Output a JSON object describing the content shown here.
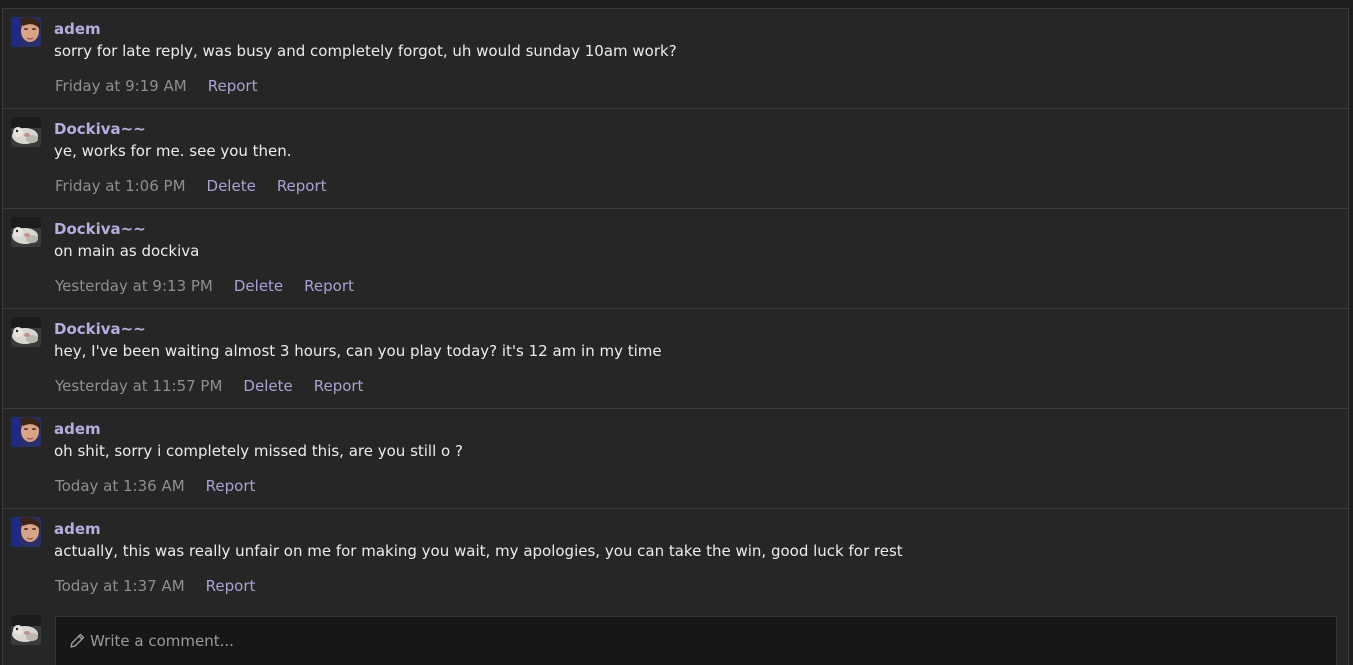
{
  "comments": [
    {
      "author": "adem",
      "avatar": "adem-avatar",
      "text": "sorry for late reply, was busy and completely forgot, uh would sunday 10am work?",
      "time": "Friday at 9:19 AM",
      "delete_label": "",
      "report_label": "Report"
    },
    {
      "author": "Dockiva~~",
      "avatar": "dockiva-avatar",
      "text": "ye, works for me. see you then.",
      "time": "Friday at 1:06 PM",
      "delete_label": "Delete",
      "report_label": "Report"
    },
    {
      "author": "Dockiva~~",
      "avatar": "dockiva-avatar",
      "text": "on main as dockiva",
      "time": "Yesterday at 9:13 PM",
      "delete_label": "Delete",
      "report_label": "Report"
    },
    {
      "author": "Dockiva~~",
      "avatar": "dockiva-avatar",
      "text": "hey, I've been waiting almost 3 hours, can you play today? it's 12 am in my time",
      "time": "Yesterday at 11:57 PM",
      "delete_label": "Delete",
      "report_label": "Report"
    },
    {
      "author": "adem",
      "avatar": "adem-avatar",
      "text": "oh shit, sorry i completely missed this, are you still o ?",
      "time": "Today at 1:36 AM",
      "delete_label": "",
      "report_label": "Report"
    },
    {
      "author": "adem",
      "avatar": "adem-avatar",
      "text": "actually, this was really unfair on me for making you wait, my apologies, you can take the win, good luck for rest",
      "time": "Today at 1:37 AM",
      "delete_label": "",
      "report_label": "Report"
    }
  ],
  "composer": {
    "placeholder": "Write a comment...",
    "icon": "pencil-icon",
    "avatar": "dockiva-avatar"
  },
  "colors": {
    "author": "#b7addf",
    "action": "#a9a2d4",
    "time": "#8f8f8f",
    "background": "#262626"
  }
}
